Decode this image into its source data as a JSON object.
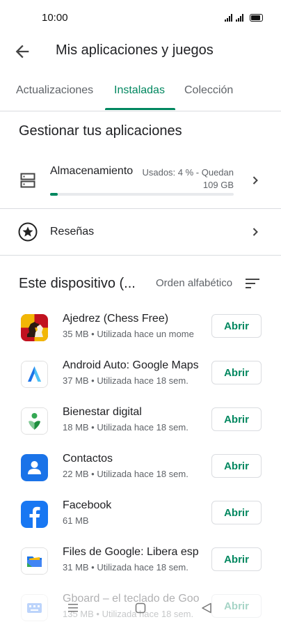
{
  "status": {
    "time": "10:00"
  },
  "header": {
    "title": "Mis aplicaciones y juegos"
  },
  "tabs": [
    {
      "label": "Actualizaciones"
    },
    {
      "label": "Instaladas"
    },
    {
      "label": "Colección"
    }
  ],
  "manage": {
    "heading": "Gestionar tus aplicaciones",
    "storage_label": "Almacenamiento",
    "storage_used": "Usados: 4 % - Quedan",
    "storage_left": "109 GB",
    "storage_fraction": 0.04,
    "reviews_label": "Reseñas"
  },
  "device": {
    "title": "Este dispositivo (...",
    "sort_label": "Orden alfabético"
  },
  "apps": [
    {
      "name": "Ajedrez (Chess Free)",
      "meta": "35 MB • Utilizada hace un mome",
      "button": "Abrir"
    },
    {
      "name": "Android Auto: Google Maps,",
      "meta": "37 MB • Utilizada hace 18 sem.",
      "button": "Abrir"
    },
    {
      "name": "Bienestar digital",
      "meta": "18 MB • Utilizada hace 18 sem.",
      "button": "Abrir"
    },
    {
      "name": "Contactos",
      "meta": "22 MB • Utilizada hace 18 sem.",
      "button": "Abrir"
    },
    {
      "name": "Facebook",
      "meta": "61 MB",
      "button": "Abrir"
    },
    {
      "name": "Files de Google: Libera espa",
      "meta": "31 MB • Utilizada hace 18 sem.",
      "button": "Abrir"
    },
    {
      "name": "Gboard – el teclado de Goo",
      "meta": "135 MB • Utilizada hace 18 sem.",
      "button": "Abrir"
    }
  ],
  "colors": {
    "accent": "#01875f",
    "divider": "#dadce0",
    "text": "#202124",
    "secondary": "#5f6368"
  }
}
